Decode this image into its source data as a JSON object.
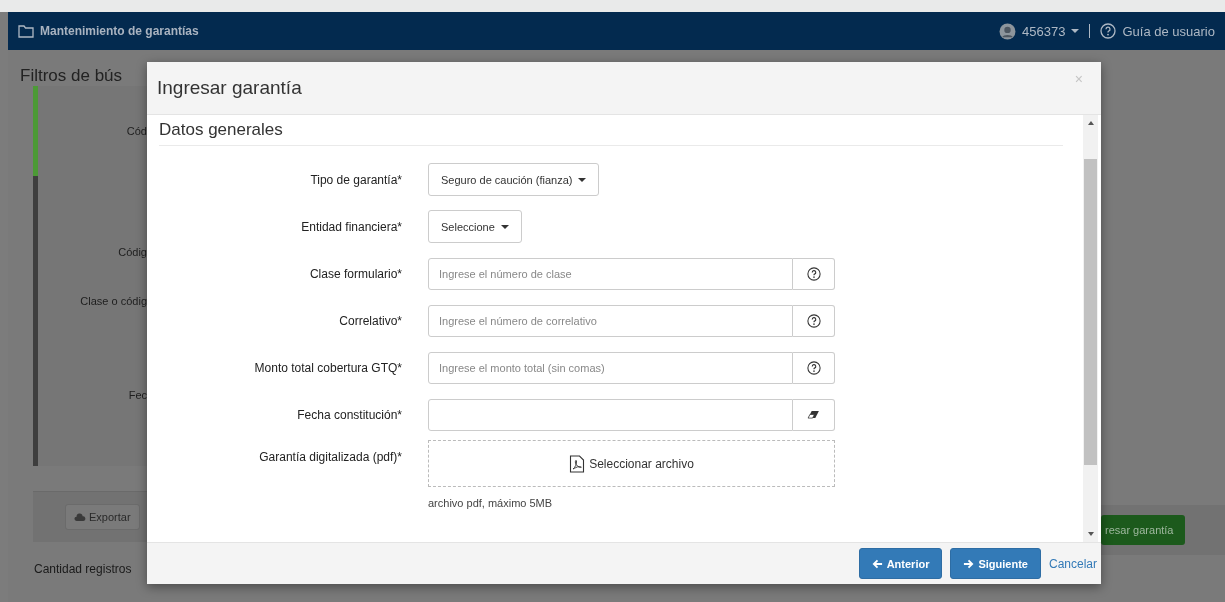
{
  "header": {
    "title": "Mantenimiento de garantías",
    "user": "456373",
    "help": "Guía de usuario"
  },
  "background": {
    "heading": "Filtros de bús",
    "top_label": "Cód",
    "labels": [
      "Códig",
      "Clase o códig",
      "Fec"
    ],
    "export_button": "Exportar",
    "add_button": "resar garantía",
    "count_label": "Cantidad registros"
  },
  "modal": {
    "title": "Ingresar garantía",
    "close": "×",
    "section": "Datos generales",
    "fields": [
      {
        "kind": "dropdown",
        "label": "Tipo de garantía*",
        "value": "Seguro de caución (fianza)"
      },
      {
        "kind": "dropdown",
        "label": "Entidad financiera*",
        "value": "Seleccione"
      },
      {
        "kind": "text",
        "label": "Clase formulario*",
        "placeholder": "Ingrese el número de clase",
        "addon": {
          "kind": "help"
        }
      },
      {
        "kind": "text",
        "label": "Correlativo*",
        "placeholder": "Ingrese el número de correlativo",
        "addon": {
          "kind": "help"
        }
      },
      {
        "kind": "text",
        "label": "Monto total cobertura GTQ*",
        "placeholder": "Ingrese el monto total (sin comas)",
        "addon": {
          "kind": "help"
        }
      },
      {
        "kind": "text",
        "label": "Fecha constitución*",
        "addon": {
          "kind": "eraser"
        }
      },
      {
        "kind": "file",
        "label": "Garantía digitalizada (pdf)*",
        "button": "Seleccionar archivo",
        "hint": "archivo pdf, máximo 5MB"
      }
    ],
    "buttons": [
      {
        "kind": "back",
        "label": "Anterior"
      },
      {
        "kind": "next",
        "label": "Siguiente"
      },
      {
        "kind": "link",
        "label": "Cancelar"
      }
    ]
  }
}
